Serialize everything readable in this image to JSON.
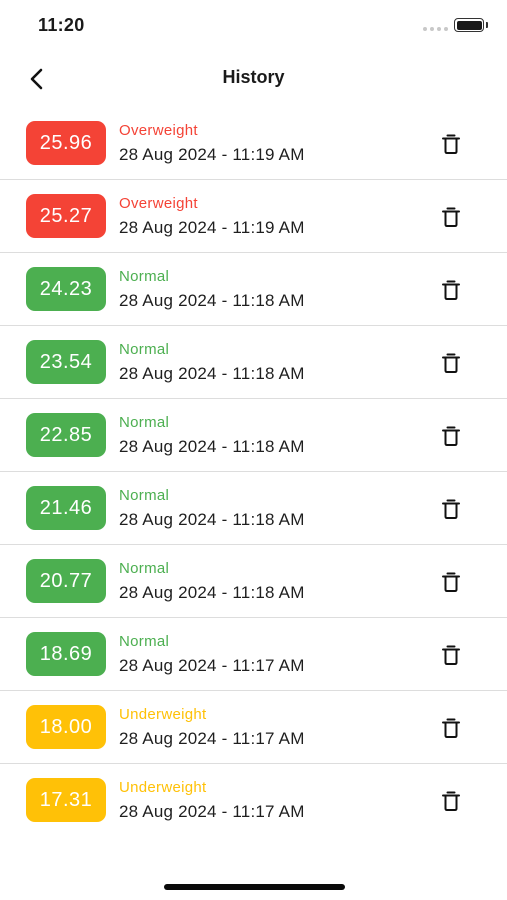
{
  "status_bar": {
    "time": "11:20",
    "battery_icon": "battery-full-icon",
    "signal_icon": "signal-dots-icon"
  },
  "header": {
    "title": "History",
    "back_icon": "chevron-left-icon"
  },
  "colors": {
    "overweight": "#F44336",
    "normal": "#4CAF50",
    "underweight": "#FFC107"
  },
  "history": [
    {
      "value": "25.96",
      "category": "Overweight",
      "date": "28 Aug 2024 - 11:19 AM",
      "color": "#F44336"
    },
    {
      "value": "25.27",
      "category": "Overweight",
      "date": "28 Aug 2024 - 11:19 AM",
      "color": "#F44336"
    },
    {
      "value": "24.23",
      "category": "Normal",
      "date": "28 Aug 2024 - 11:18 AM",
      "color": "#4CAF50"
    },
    {
      "value": "23.54",
      "category": "Normal",
      "date": "28 Aug 2024 - 11:18 AM",
      "color": "#4CAF50"
    },
    {
      "value": "22.85",
      "category": "Normal",
      "date": "28 Aug 2024 - 11:18 AM",
      "color": "#4CAF50"
    },
    {
      "value": "21.46",
      "category": "Normal",
      "date": "28 Aug 2024 - 11:18 AM",
      "color": "#4CAF50"
    },
    {
      "value": "20.77",
      "category": "Normal",
      "date": "28 Aug 2024 - 11:18 AM",
      "color": "#4CAF50"
    },
    {
      "value": "18.69",
      "category": "Normal",
      "date": "28 Aug 2024 - 11:17 AM",
      "color": "#4CAF50"
    },
    {
      "value": "18.00",
      "category": "Underweight",
      "date": "28 Aug 2024 - 11:17 AM",
      "color": "#FFC107"
    },
    {
      "value": "17.31",
      "category": "Underweight",
      "date": "28 Aug 2024 - 11:17 AM",
      "color": "#FFC107"
    }
  ],
  "row_delete_icon": "trash-icon"
}
